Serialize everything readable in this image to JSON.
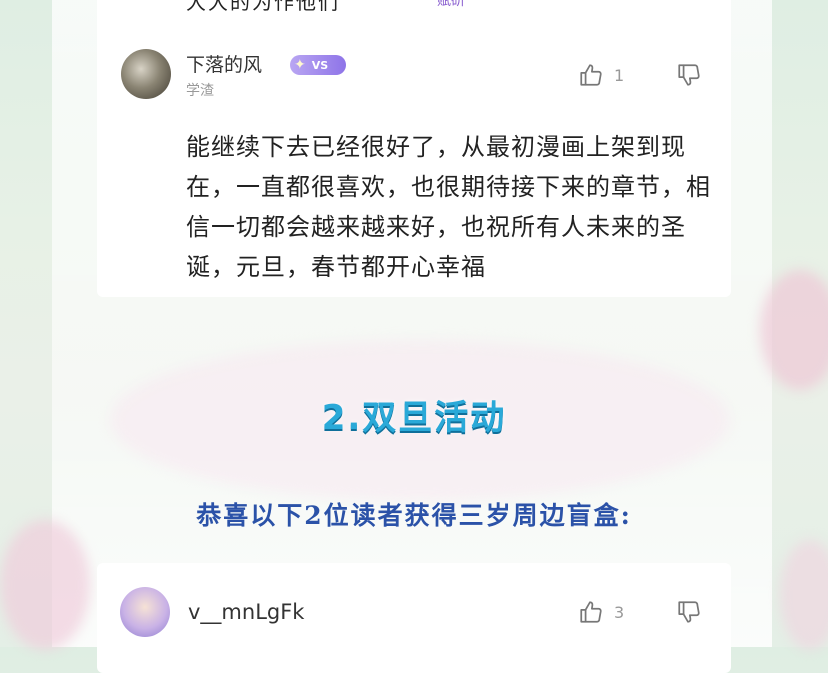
{
  "top_partial": {
    "text": "大大的为作他们",
    "tag": "赋研"
  },
  "comment_1": {
    "username": "下落的风",
    "badge": "VS",
    "level": "学渣",
    "like_count": "1",
    "text": "能继续下去已经很好了，从最初漫画上架到现在，一直都很喜欢，也很期待接下来的章节，相信一切都会越来越来好，也祝所有人未来的圣诞，元旦，春节都开心幸福"
  },
  "section": {
    "title": "2.双旦活动",
    "announcement": "恭喜以下2位读者获得三岁周边盲盒:"
  },
  "comment_2": {
    "username": "v__mnLgFk",
    "like_count": "3"
  },
  "icons": {
    "like": "thumbs-up-icon",
    "dislike": "thumbs-down-icon",
    "badge": "sparkle-icon"
  },
  "colors": {
    "title_blue": "#2aa9d8",
    "announcement_blue": "#2b52a8",
    "badge_purple": "#8e74e8"
  }
}
